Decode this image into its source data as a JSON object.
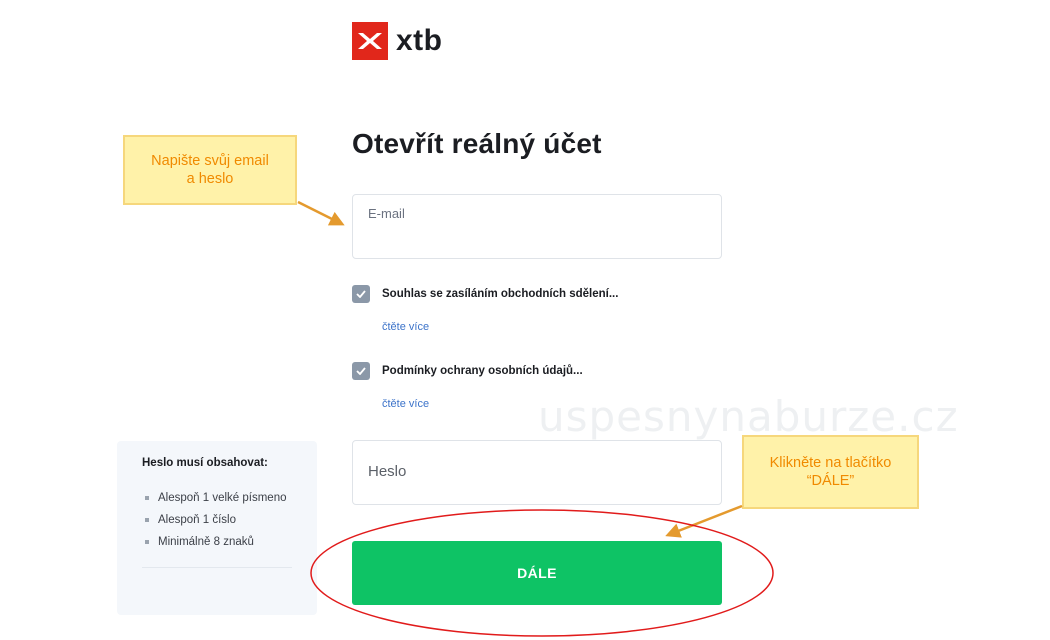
{
  "brand": {
    "name": "xtb",
    "mark_color": "#e1271b"
  },
  "form": {
    "title": "Otevřít reálný účet",
    "email_label": "E-mail",
    "password_placeholder": "Heslo",
    "consents": [
      {
        "label": "Souhlas se zasíláním obchodních sdělení...",
        "checked": true,
        "read_more": "čtěte více"
      },
      {
        "label": "Podmínky ochrany osobních údajů...",
        "checked": true,
        "read_more": "čtěte více"
      }
    ],
    "submit_label": "DÁLE",
    "submit_color": "#0ec365"
  },
  "password_rules": {
    "title": "Heslo musí obsahovat:",
    "items": [
      "Alespoň 1 velké písmeno",
      "Alespoň 1 číslo",
      "Minimálně 8 znaků"
    ]
  },
  "annotations": {
    "email_note": [
      "Napište svůj email",
      "a heslo"
    ],
    "button_note": [
      "Klikněte na tlačítko",
      "“DÁLE”"
    ],
    "note_color": "#f08a00",
    "highlight_color": "#e11b1b"
  },
  "watermark": "uspesnynaburze.cz",
  "icons": {
    "check": "check-icon",
    "logo": "xtb-x-logo-icon"
  }
}
